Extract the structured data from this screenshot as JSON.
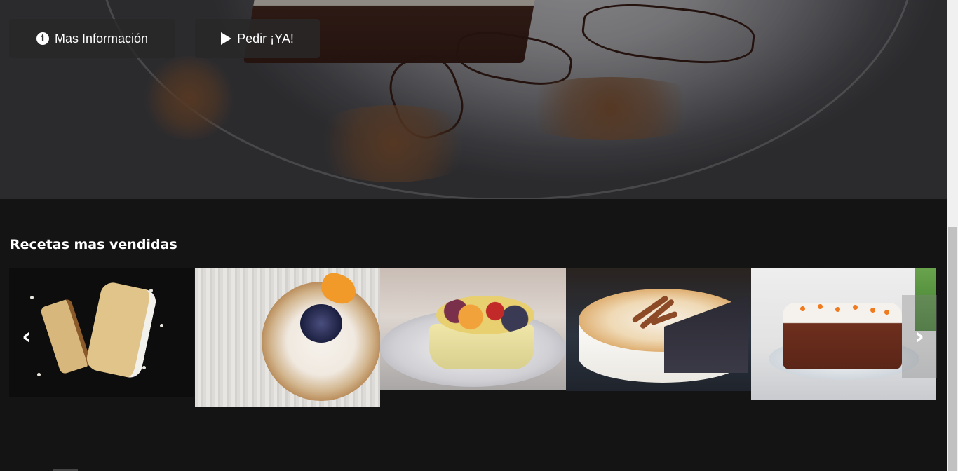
{
  "hero": {
    "info_button": {
      "label": "Mas Información",
      "icon": "info-circle-icon"
    },
    "order_button": {
      "label": "Pedir ¡YA!",
      "icon": "play-icon"
    }
  },
  "section": {
    "title": "Recetas mas vendidas"
  },
  "carousel": {
    "prev_icon": "chevron-left-icon",
    "next_icon": "chevron-right-icon",
    "prev_glyph": "‹",
    "next_glyph": "›"
  },
  "colors": {
    "background": "#141414",
    "button_bg": "#282828",
    "text": "#ffffff"
  }
}
